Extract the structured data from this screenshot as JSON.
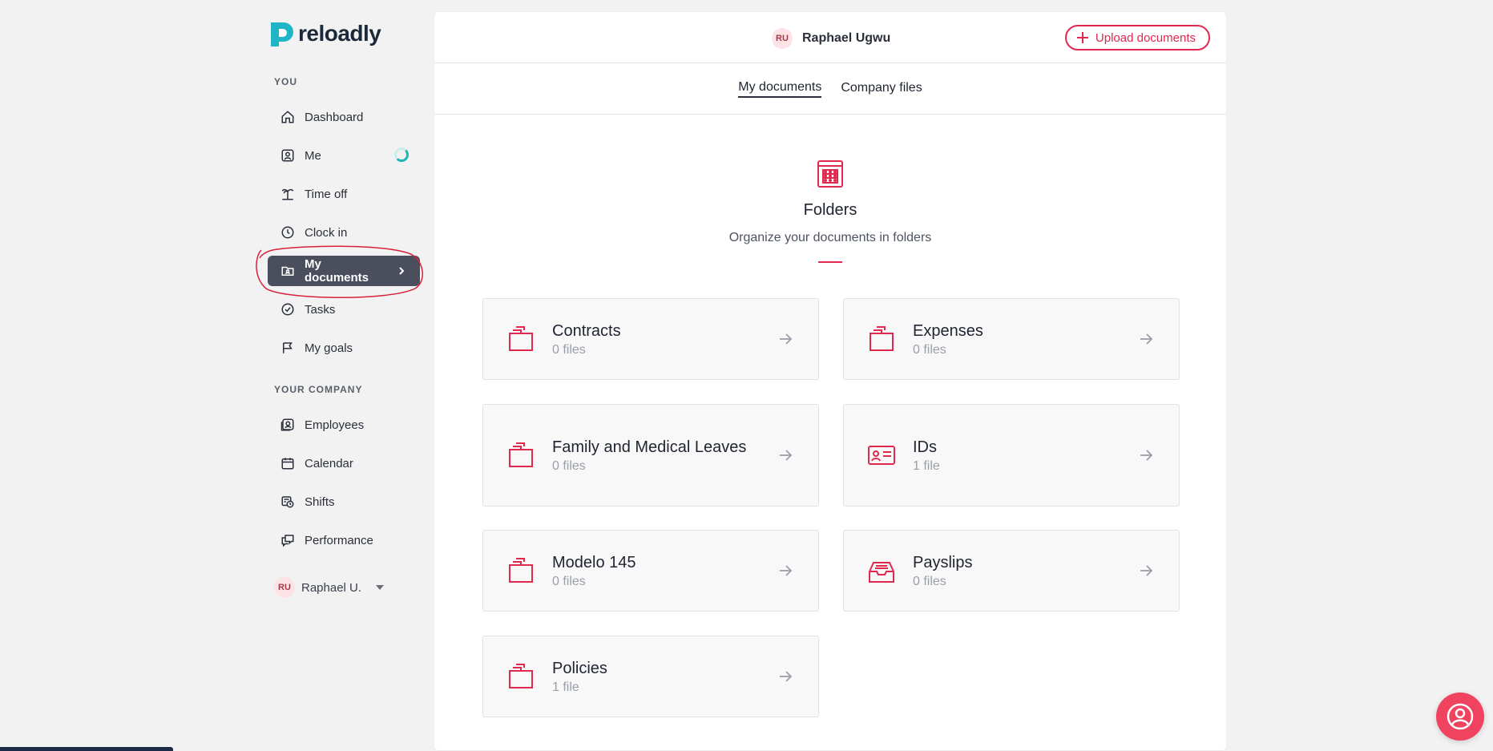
{
  "app": {
    "logo_text": "reloadly"
  },
  "sidebar": {
    "section_you": "YOU",
    "section_company": "YOUR COMPANY",
    "items": [
      {
        "label": "Dashboard",
        "icon": "home-icon"
      },
      {
        "label": "Me",
        "icon": "user-square-icon"
      },
      {
        "label": "Time off",
        "icon": "palm-tree-icon"
      },
      {
        "label": "Clock in",
        "icon": "clock-icon"
      },
      {
        "label": "My documents",
        "icon": "folder-user-icon",
        "active": true
      },
      {
        "label": "Tasks",
        "icon": "check-circle-icon"
      },
      {
        "label": "My goals",
        "icon": "flag-icon"
      }
    ],
    "company_items": [
      {
        "label": "Employees",
        "icon": "users-icon"
      },
      {
        "label": "Calendar",
        "icon": "calendar-icon"
      },
      {
        "label": "Shifts",
        "icon": "shifts-icon"
      },
      {
        "label": "Performance",
        "icon": "chat-bubbles-icon"
      }
    ],
    "user": {
      "initials": "RU",
      "name": "Raphael U."
    }
  },
  "header": {
    "user_initials": "RU",
    "user_name": "Raphael Ugwu",
    "upload_label": "Upload documents"
  },
  "tabs": [
    {
      "label": "My documents",
      "active": true
    },
    {
      "label": "Company files",
      "active": false
    }
  ],
  "hero": {
    "title": "Folders",
    "subtitle": "Organize your documents in folders"
  },
  "folders": [
    {
      "name": "Contracts",
      "count": "0 files",
      "icon": "folder-icon"
    },
    {
      "name": "Expenses",
      "count": "0 files",
      "icon": "folder-icon"
    },
    {
      "name": "Family and Medical Leaves",
      "count": "0 files",
      "icon": "folder-icon"
    },
    {
      "name": "IDs",
      "count": "1 file",
      "icon": "id-card-icon"
    },
    {
      "name": "Modelo 145",
      "count": "0 files",
      "icon": "folder-icon"
    },
    {
      "name": "Payslips",
      "count": "0 files",
      "icon": "inbox-tray-icon"
    },
    {
      "name": "Policies",
      "count": "1 file",
      "icon": "folder-icon"
    }
  ],
  "colors": {
    "accent": "#e0294f",
    "active_nav": "#4a4e5d",
    "help_button": "#f0435f"
  }
}
